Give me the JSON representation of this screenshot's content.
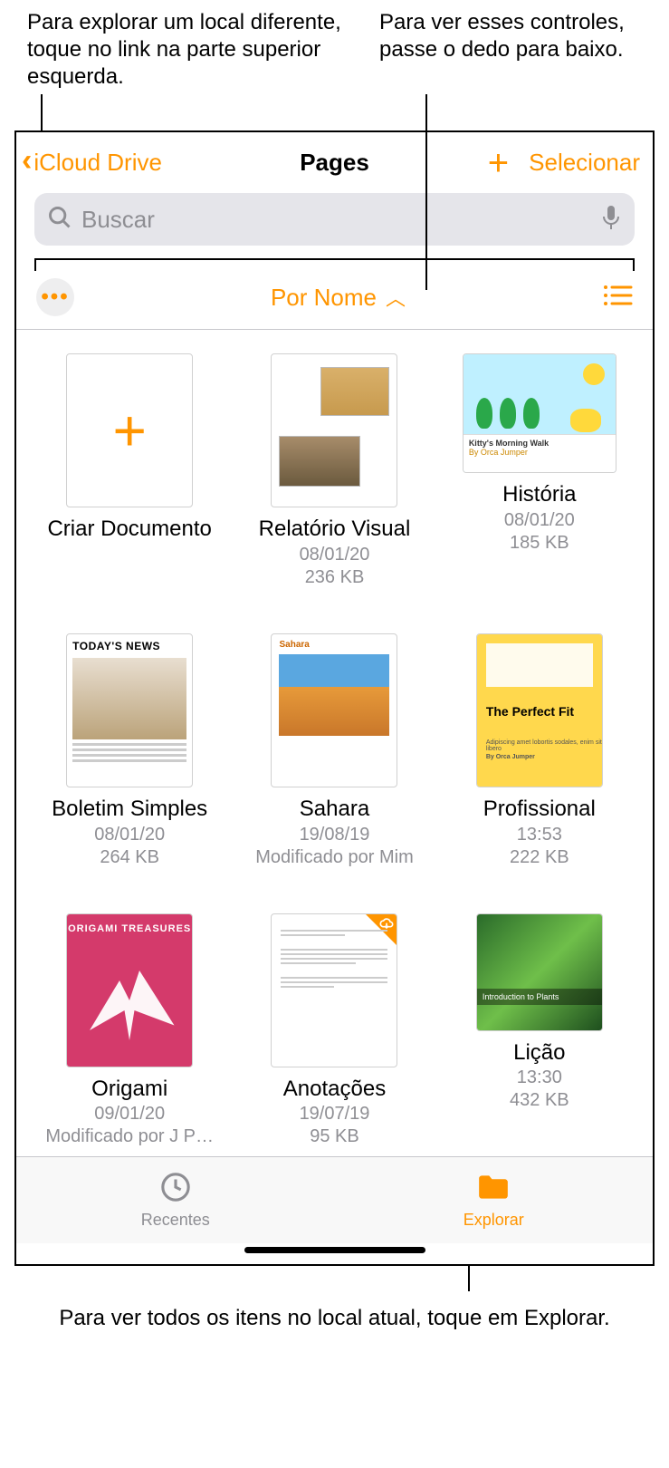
{
  "callouts": {
    "topLeft": "Para explorar um local diferente, toque no link na parte superior esquerda.",
    "topRight": "Para ver esses controles, passe o dedo para baixo.",
    "bottom": "Para ver todos os itens no local atual, toque em Explorar."
  },
  "topbar": {
    "back": "iCloud Drive",
    "title": "Pages",
    "select": "Selecionar"
  },
  "search": {
    "placeholder": "Buscar"
  },
  "sort": {
    "label": "Por Nome"
  },
  "docs": {
    "create": "Criar Documento",
    "items": [
      {
        "title": "Relatório Visual",
        "date": "08/01/20",
        "meta": "236 KB"
      },
      {
        "title": "História",
        "date": "08/01/20",
        "meta": "185 KB",
        "storyTitle": "Kitty's Morning Walk",
        "storyAuthor": "By Orca Jumper"
      },
      {
        "title": "Boletim Simples",
        "date": "08/01/20",
        "meta": "264 KB",
        "newsHeadline": "TODAY'S NEWS"
      },
      {
        "title": "Sahara",
        "date": "19/08/19",
        "meta": "Modificado por Mim",
        "saharaLabel": "Sahara"
      },
      {
        "title": "Profissional",
        "date": "13:53",
        "meta": "222 KB",
        "fitTitle": "The Perfect Fit",
        "fitSub": "Adipiscing amet lobortis sodales, enim sit libero",
        "fitAuthor": "By Orca Jumper"
      },
      {
        "title": "Origami",
        "date": "09/01/20",
        "meta": "Modificado por J P…",
        "origamiTitle": "ORIGAMI TREASURES"
      },
      {
        "title": "Anotações",
        "date": "19/07/19",
        "meta": "95 KB"
      },
      {
        "title": "Lição",
        "date": "13:30",
        "meta": "432 KB",
        "plantTitle": "Introduction to Plants"
      }
    ]
  },
  "tabs": {
    "recent": "Recentes",
    "browse": "Explorar"
  }
}
